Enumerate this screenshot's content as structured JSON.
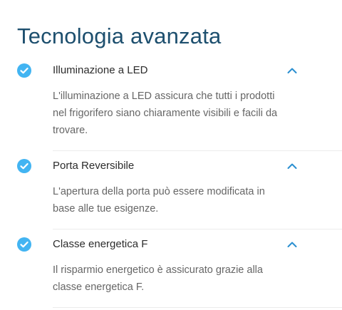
{
  "section_title": "Tecnologia avanzata",
  "accent_color": "#42b4f2",
  "title_color": "#1d4f6e",
  "items": [
    {
      "title": "Illuminazione a LED",
      "description": "L'illuminazione a LED assicura che tutti i prodotti nel frigorifero siano chiaramente visibili e facili da trovare.",
      "icon": "check-circle-icon",
      "toggle_icon": "chevron-up-icon",
      "expanded": true
    },
    {
      "title": "Porta Reversibile",
      "description": "L'apertura della porta può essere modificata in base alle tue esigenze.",
      "icon": "check-circle-icon",
      "toggle_icon": "chevron-up-icon",
      "expanded": true
    },
    {
      "title": "Classe energetica F",
      "description": "Il risparmio energetico è assicurato grazie alla classe energetica F.",
      "icon": "check-circle-icon",
      "toggle_icon": "chevron-up-icon",
      "expanded": true
    }
  ]
}
